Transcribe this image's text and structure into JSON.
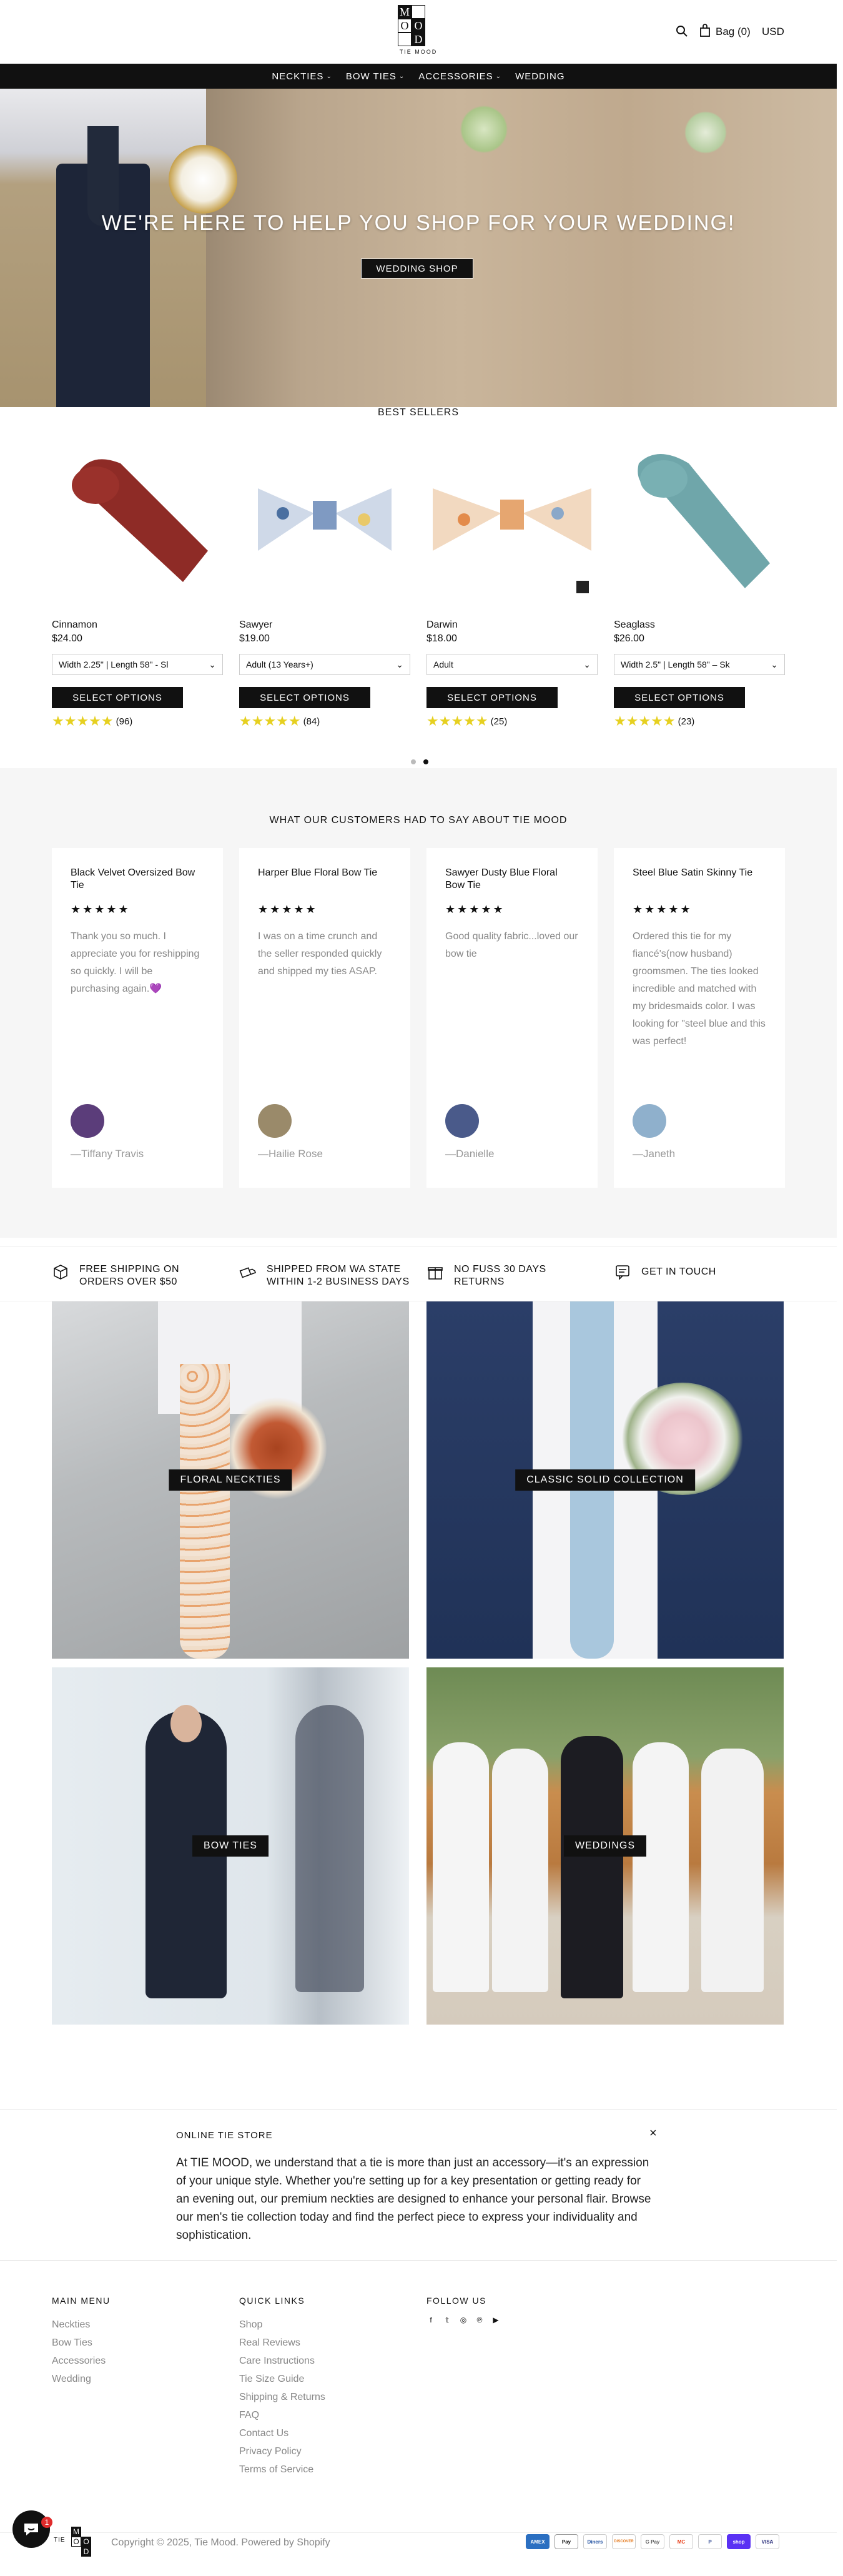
{
  "header": {
    "logo_letters": [
      "M",
      "O",
      "O",
      "D"
    ],
    "logo_sub": "TIE MOOD",
    "bag_label": "Bag (0)",
    "currency": "USD"
  },
  "nav": {
    "items": [
      {
        "label": "NECKTIES",
        "has_dropdown": true
      },
      {
        "label": "BOW TIES",
        "has_dropdown": true
      },
      {
        "label": "ACCESSORIES",
        "has_dropdown": true
      },
      {
        "label": "WEDDING",
        "has_dropdown": false
      }
    ]
  },
  "hero": {
    "title": "WE'RE HERE TO HELP YOU SHOP FOR YOUR WEDDING!",
    "button": "WEDDING SHOP"
  },
  "best_sellers": {
    "title": "BEST SELLERS",
    "products": [
      {
        "name": "Cinnamon",
        "price": "$24.00",
        "variant": "Width 2.25\" | Length 58\" - Sl",
        "button": "SELECT OPTIONS",
        "reviews": "(96)",
        "rating": 5,
        "color": "#8e2b26"
      },
      {
        "name": "Sawyer",
        "price": "$19.00",
        "variant": "Adult (13 Years+)",
        "button": "SELECT OPTIONS",
        "reviews": "(84)",
        "rating": 5,
        "color": "#7f9ac2"
      },
      {
        "name": "Darwin",
        "price": "$18.00",
        "variant": "Adult",
        "button": "SELECT OPTIONS",
        "reviews": "(25)",
        "rating": 5,
        "color": "#e6a670"
      },
      {
        "name": "Seaglass",
        "price": "$26.00",
        "variant": "Width 2.5\" | Length 58\" – Sk",
        "button": "SELECT OPTIONS",
        "reviews": "(23)",
        "rating": 5,
        "color": "#6fa6aa"
      }
    ],
    "carousel_page": 2,
    "carousel_total": 2
  },
  "reviews": {
    "title": "WHAT OUR CUSTOMERS HAD TO SAY ABOUT TIE MOOD",
    "items": [
      {
        "title": "Black Velvet Oversized Bow Tie",
        "stars": "★★★★★",
        "body": "Thank you so much. I appreciate you for reshipping so quickly. I will be purchasing again.💜",
        "author": "—Tiffany Travis",
        "avatar_color": "#5b3d7a"
      },
      {
        "title": "Harper Blue Floral Bow Tie",
        "stars": "★★★★★",
        "body": "I was on a time crunch and the seller responded quickly and shipped my ties ASAP.",
        "author": "—Hailie Rose",
        "avatar_color": "#9a8a6a"
      },
      {
        "title": "Sawyer Dusty Blue Floral Bow Tie",
        "stars": "★★★★★",
        "body": "Good quality fabric...loved our bow tie",
        "author": "—Danielle",
        "avatar_color": "#4a5a8a"
      },
      {
        "title": "Steel Blue Satin Skinny Tie",
        "stars": "★★★★★",
        "body": "Ordered this tie for my fiancé's(now husband) groomsmen. The ties looked incredible and matched with my bridesmaids color. I was looking for \"steel blue and this was perfect!",
        "author": "—Janeth",
        "avatar_color": "#8fb0cc"
      }
    ]
  },
  "benefits": [
    {
      "icon": "box-icon",
      "text": "FREE SHIPPING ON ORDERS OVER $50"
    },
    {
      "icon": "truck-icon",
      "text": "SHIPPED FROM WA STATE WITHIN 1-2 BUSINESS DAYS"
    },
    {
      "icon": "gift-icon",
      "text": "NO FUSS 30 DAYS RETURNS"
    },
    {
      "icon": "chat-icon",
      "text": "GET IN TOUCH"
    }
  ],
  "collections": [
    {
      "label": "FLORAL NECKTIES"
    },
    {
      "label": "CLASSIC SOLID COLLECTION"
    },
    {
      "label": "BOW TIES"
    },
    {
      "label": "WEDDINGS"
    }
  ],
  "about": {
    "title": "ONLINE TIE STORE",
    "close": "×",
    "body": "At TIE MOOD, we understand that a tie is more than just an accessory—it's an expression of your unique style. Whether you're setting up for a key presentation or getting ready for an evening out, our premium neckties are designed to enhance your personal flair. Browse our men's tie collection today and find the perfect piece to express your individuality and sophistication."
  },
  "footer": {
    "main_menu": {
      "title": "MAIN MENU",
      "links": [
        "Neckties",
        "Bow Ties",
        "Accessories",
        "Wedding"
      ]
    },
    "quick_links": {
      "title": "QUICK LINKS",
      "links": [
        "Shop",
        "Real Reviews",
        "Care Instructions",
        "Tie Size Guide",
        "Shipping & Returns",
        "FAQ",
        "Contact Us",
        "Privacy Policy",
        "Terms of Service"
      ]
    },
    "follow_us": {
      "title": "FOLLOW US",
      "icons": [
        "facebook-icon",
        "twitter-icon",
        "instagram-icon",
        "pinterest-icon",
        "youtube-icon"
      ]
    },
    "copyright": "Copyright © 2025, Tie Mood. Powered by Shopify",
    "chat_badge": "1",
    "payments": [
      "AMEX",
      "Pay",
      "Diners",
      "DISCOVER",
      "G Pay",
      "MC",
      "P",
      "shop",
      "VISA"
    ]
  }
}
